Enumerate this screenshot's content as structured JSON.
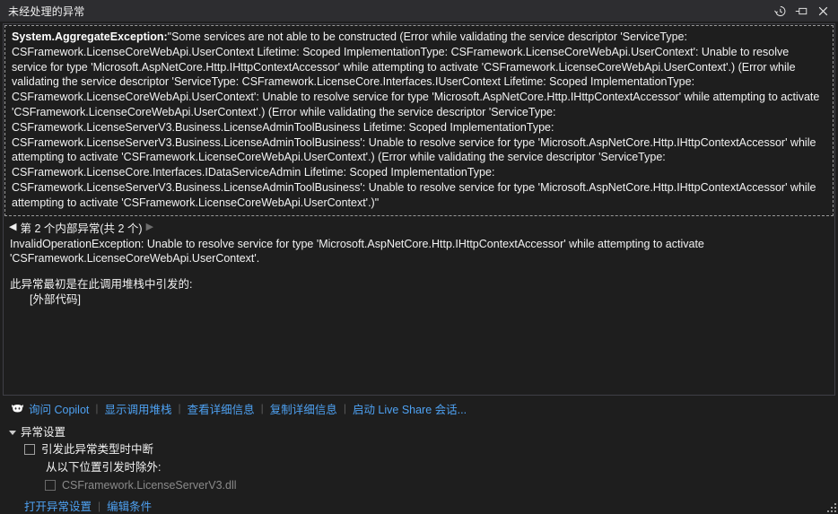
{
  "window": {
    "title": "未经处理的异常",
    "buttons": [
      {
        "name": "history-icon",
        "label": "历史记录"
      },
      {
        "name": "dock-icon",
        "label": "停靠"
      },
      {
        "name": "close-icon",
        "label": "关闭"
      }
    ]
  },
  "exception": {
    "type": "System.AggregateException:",
    "message": "\"Some services are not able to be constructed (Error while validating the service descriptor 'ServiceType: CSFramework.LicenseCoreWebApi.UserContext Lifetime: Scoped ImplementationType: CSFramework.LicenseCoreWebApi.UserContext': Unable to resolve service for type 'Microsoft.AspNetCore.Http.IHttpContextAccessor' while attempting to activate 'CSFramework.LicenseCoreWebApi.UserContext'.) (Error while validating the service descriptor 'ServiceType: CSFramework.LicenseCore.Interfaces.IUserContext Lifetime: Scoped ImplementationType: CSFramework.LicenseCoreWebApi.UserContext': Unable to resolve service for type 'Microsoft.AspNetCore.Http.IHttpContextAccessor' while attempting to activate 'CSFramework.LicenseCoreWebApi.UserContext'.) (Error while validating the service descriptor 'ServiceType: CSFramework.LicenseServerV3.Business.LicenseAdminToolBusiness Lifetime: Scoped ImplementationType: CSFramework.LicenseServerV3.Business.LicenseAdminToolBusiness': Unable to resolve service for type 'Microsoft.AspNetCore.Http.IHttpContextAccessor' while attempting to activate 'CSFramework.LicenseCoreWebApi.UserContext'.) (Error while validating the service descriptor 'ServiceType: CSFramework.LicenseCore.Interfaces.IDataServiceAdmin Lifetime: Scoped ImplementationType: CSFramework.LicenseServerV3.Business.LicenseAdminToolBusiness': Unable to resolve service for type 'Microsoft.AspNetCore.Http.IHttpContextAccessor' while attempting to activate 'CSFramework.LicenseCoreWebApi.UserContext'.)\""
  },
  "inner_nav": {
    "prev_arrow": "◀",
    "next_arrow": "▶",
    "label": "第 2 个内部异常(共 2 个)",
    "current_index": 2,
    "total": 2,
    "prev_enabled": true,
    "next_enabled": false
  },
  "inner_exception": {
    "text": "InvalidOperationException: Unable to resolve service for type 'Microsoft.AspNetCore.Http.IHttpContextAccessor' while attempting to activate 'CSFramework.LicenseCoreWebApi.UserContext'."
  },
  "stack": {
    "title": "此异常最初是在此调用堆栈中引发的:",
    "frames": [
      "[外部代码]"
    ]
  },
  "actions": {
    "copilot_icon": "copilot-icon",
    "links": [
      "询问 Copilot",
      "显示调用堆栈",
      "查看详细信息",
      "复制详细信息",
      "启动 Live Share 会话..."
    ],
    "separator": "|"
  },
  "settings": {
    "header": "异常设置",
    "break_checkbox_label": "引发此异常类型时中断",
    "break_checkbox_checked": false,
    "except_when_label": "从以下位置引发时除外:",
    "module_checkbox_label": "CSFramework.LicenseServerV3.dll",
    "module_checkbox_checked": false,
    "module_checkbox_enabled": false,
    "links": [
      "打开异常设置",
      "编辑条件"
    ],
    "separator": "|"
  },
  "colors": {
    "window_bg": "#1e1e1e",
    "titlebar_bg": "#2d2d30",
    "link": "#4ea1f2",
    "text": "#f2f2f2",
    "border": "#3f3f46",
    "disabled_text": "#8a8a8a"
  }
}
